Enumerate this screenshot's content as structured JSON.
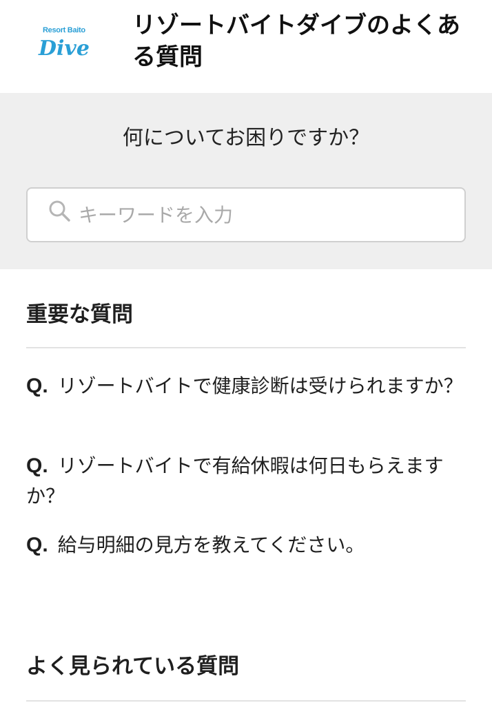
{
  "header": {
    "logo_small_text": "Resort Baito",
    "logo_main_text": "Dive",
    "title": "リゾートバイトダイブのよくある質問"
  },
  "search": {
    "heading": "何についてお困りですか？",
    "placeholder": "キーワードを入力",
    "value": ""
  },
  "important": {
    "title": "重要な質問",
    "prefix": "Q.",
    "questions": [
      "リゾートバイトで健康診断は受けられますか？",
      "リゾートバイトで有給休暇は何日もらえますか？",
      "給与明細の見方を教えてください。"
    ]
  },
  "popular": {
    "title": "よく見られている質問"
  },
  "colors": {
    "brand": "#2a9fd6",
    "search_bg": "#efefef"
  }
}
